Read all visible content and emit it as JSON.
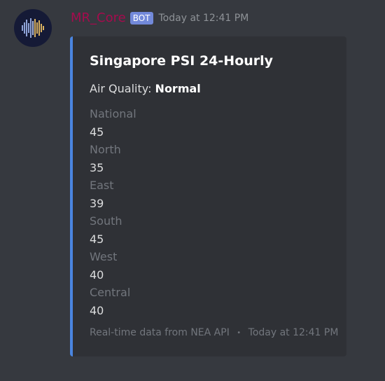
{
  "message": {
    "username": "MR_Core",
    "bot_tag": "BOT",
    "timestamp": "Today at 12:41 PM",
    "avatar_icon": "audio-waveform-icon",
    "username_color": "#a50b4d",
    "accent_color": "#4a85e0"
  },
  "embed": {
    "title": "Singapore PSI 24-Hourly",
    "description_label": "Air Quality:",
    "description_value": "Normal",
    "fields": [
      {
        "name": "National",
        "value": "45"
      },
      {
        "name": "North",
        "value": "35"
      },
      {
        "name": "East",
        "value": "39"
      },
      {
        "name": "South",
        "value": "45"
      },
      {
        "name": "West",
        "value": "40"
      },
      {
        "name": "Central",
        "value": "40"
      }
    ],
    "footer_text": "Real-time data from NEA API",
    "footer_separator": "•",
    "footer_timestamp": "Today at 12:41 PM"
  }
}
